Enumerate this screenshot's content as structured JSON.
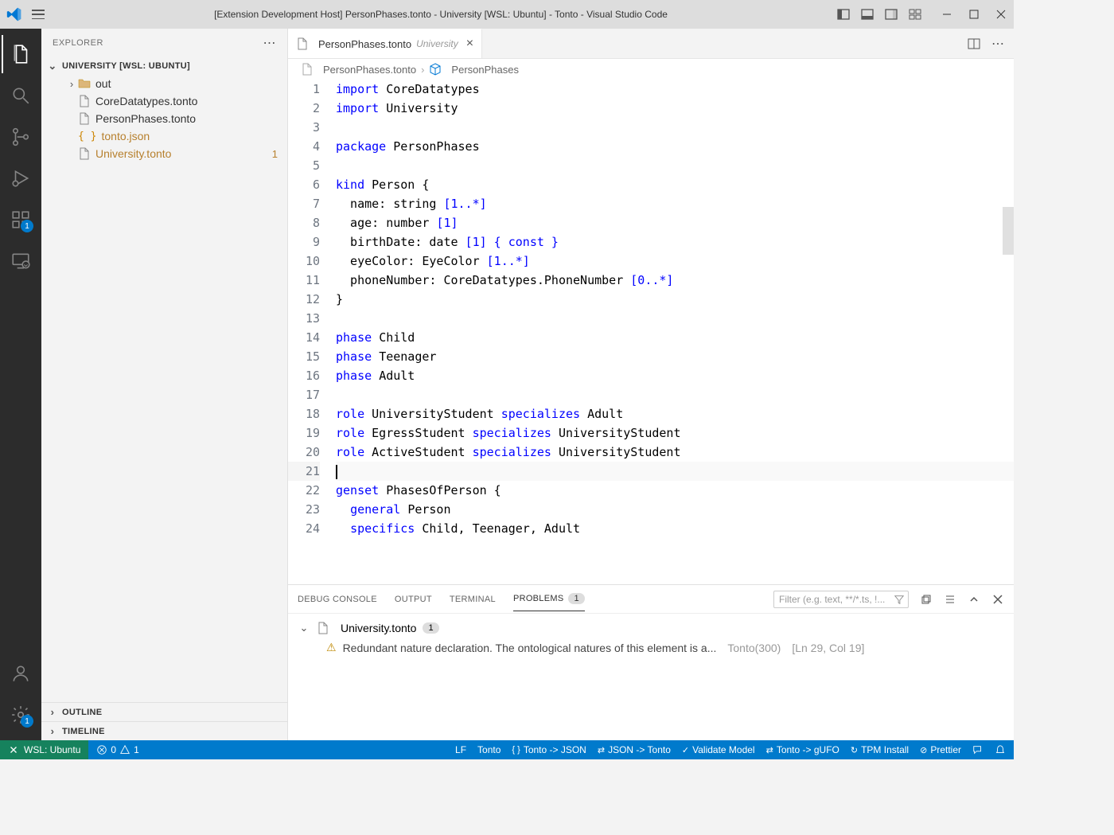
{
  "titlebar": {
    "title": "[Extension Development Host] PersonPhases.tonto - University [WSL: Ubuntu] - Tonto - Visual Studio Code"
  },
  "sidebar": {
    "title": "EXPLORER",
    "folder": "UNIVERSITY [WSL: UBUNTU]",
    "tree": [
      {
        "name": "out",
        "type": "folder",
        "indent": 1
      },
      {
        "name": "CoreDatatypes.tonto",
        "type": "file",
        "indent": 1
      },
      {
        "name": "PersonPhases.tonto",
        "type": "file",
        "indent": 1
      },
      {
        "name": "tonto.json",
        "type": "json",
        "indent": 1,
        "warning": true
      },
      {
        "name": "University.tonto",
        "type": "file",
        "indent": 1,
        "warning": true,
        "badge": "1"
      }
    ],
    "sections": {
      "outline": "OUTLINE",
      "timeline": "TIMELINE"
    }
  },
  "tabs": {
    "label": "PersonPhases.tonto",
    "desc": "University"
  },
  "breadcrumb": {
    "file": "PersonPhases.tonto",
    "symbol": "PersonPhases"
  },
  "code": {
    "lines": [
      [
        {
          "t": "import ",
          "c": "kw"
        },
        {
          "t": "CoreDatatypes",
          "c": ""
        }
      ],
      [
        {
          "t": "import ",
          "c": "kw"
        },
        {
          "t": "University",
          "c": ""
        }
      ],
      [],
      [
        {
          "t": "package ",
          "c": "kw"
        },
        {
          "t": "PersonPhases",
          "c": ""
        }
      ],
      [],
      [
        {
          "t": "kind ",
          "c": "kw"
        },
        {
          "t": "Person {",
          "c": ""
        }
      ],
      [
        {
          "t": "  name: string ",
          "c": ""
        },
        {
          "t": "[1..*]",
          "c": "kw"
        }
      ],
      [
        {
          "t": "  age: number ",
          "c": ""
        },
        {
          "t": "[1]",
          "c": "kw"
        }
      ],
      [
        {
          "t": "  birthDate: date ",
          "c": ""
        },
        {
          "t": "[1] { ",
          "c": "kw"
        },
        {
          "t": "const",
          "c": "kw"
        },
        {
          "t": " }",
          "c": "kw"
        }
      ],
      [
        {
          "t": "  eyeColor: EyeColor ",
          "c": ""
        },
        {
          "t": "[1..*]",
          "c": "kw"
        }
      ],
      [
        {
          "t": "  phoneNumber: CoreDatatypes.PhoneNumber ",
          "c": ""
        },
        {
          "t": "[0..*]",
          "c": "kw"
        }
      ],
      [
        {
          "t": "}",
          "c": ""
        }
      ],
      [],
      [
        {
          "t": "phase ",
          "c": "kw"
        },
        {
          "t": "Child",
          "c": ""
        }
      ],
      [
        {
          "t": "phase ",
          "c": "kw"
        },
        {
          "t": "Teenager",
          "c": ""
        }
      ],
      [
        {
          "t": "phase ",
          "c": "kw"
        },
        {
          "t": "Adult",
          "c": ""
        }
      ],
      [],
      [
        {
          "t": "role ",
          "c": "kw"
        },
        {
          "t": "UniversityStudent ",
          "c": ""
        },
        {
          "t": "specializes ",
          "c": "kw"
        },
        {
          "t": "Adult",
          "c": ""
        }
      ],
      [
        {
          "t": "role ",
          "c": "kw"
        },
        {
          "t": "EgressStudent ",
          "c": ""
        },
        {
          "t": "specializes ",
          "c": "kw"
        },
        {
          "t": "UniversityStudent",
          "c": ""
        }
      ],
      [
        {
          "t": "role ",
          "c": "kw"
        },
        {
          "t": "ActiveStudent ",
          "c": ""
        },
        {
          "t": "specializes ",
          "c": "kw"
        },
        {
          "t": "UniversityStudent",
          "c": ""
        }
      ],
      [],
      [
        {
          "t": "genset ",
          "c": "kw"
        },
        {
          "t": "PhasesOfPerson {",
          "c": ""
        }
      ],
      [
        {
          "t": "  ",
          "c": ""
        },
        {
          "t": "general ",
          "c": "kw"
        },
        {
          "t": "Person",
          "c": ""
        }
      ],
      [
        {
          "t": "  ",
          "c": ""
        },
        {
          "t": "specifics ",
          "c": "kw"
        },
        {
          "t": "Child, Teenager, Adult",
          "c": ""
        }
      ]
    ],
    "current_line": 21
  },
  "panel": {
    "tabs": {
      "debug": "DEBUG CONSOLE",
      "output": "OUTPUT",
      "terminal": "TERMINAL",
      "problems": "PROBLEMS",
      "problems_count": "1"
    },
    "filter_placeholder": "Filter (e.g. text, **/*.ts, !...",
    "problem_file": "University.tonto",
    "problem_file_count": "1",
    "problem_msg": "Redundant nature declaration. The ontological natures of this element is a...",
    "problem_source": "Tonto(300)",
    "problem_loc": "[Ln 29, Col 19]"
  },
  "statusbar": {
    "remote": "WSL: Ubuntu",
    "errors": "0",
    "warnings": "1",
    "lf": "LF",
    "lang": "Tonto",
    "items": [
      "Tonto -> JSON",
      "JSON -> Tonto",
      "Validate Model",
      "Tonto -> gUFO",
      "TPM Install",
      "Prettier"
    ]
  }
}
